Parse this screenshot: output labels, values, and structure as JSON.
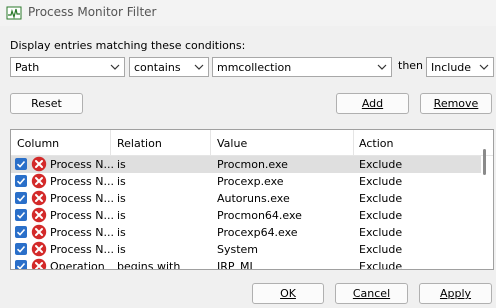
{
  "window": {
    "title": "Process Monitor Filter"
  },
  "conditions_label": "Display entries matching these conditions:",
  "filter": {
    "column": "Path",
    "relation": "contains",
    "value": "mmcollection",
    "then_label": "then",
    "action": "Include"
  },
  "buttons": {
    "reset": "Reset",
    "add": "Add",
    "remove": "Remove",
    "ok": "OK",
    "cancel": "Cancel",
    "apply": "Apply"
  },
  "table": {
    "headers": [
      "Column",
      "Relation",
      "Value",
      "Action"
    ],
    "rows": [
      {
        "column": "Process N...",
        "relation": "is",
        "value": "Procmon.exe",
        "action": "Exclude",
        "checked": true,
        "selected": true
      },
      {
        "column": "Process N...",
        "relation": "is",
        "value": "Procexp.exe",
        "action": "Exclude",
        "checked": true
      },
      {
        "column": "Process N...",
        "relation": "is",
        "value": "Autoruns.exe",
        "action": "Exclude",
        "checked": true
      },
      {
        "column": "Process N...",
        "relation": "is",
        "value": "Procmon64.exe",
        "action": "Exclude",
        "checked": true
      },
      {
        "column": "Process N...",
        "relation": "is",
        "value": "Procexp64.exe",
        "action": "Exclude",
        "checked": true
      },
      {
        "column": "Process N...",
        "relation": "is",
        "value": "System",
        "action": "Exclude",
        "checked": true
      },
      {
        "column": "Operation",
        "relation": "begins with",
        "value": "IRP_MJ_",
        "action": "Exclude",
        "checked": true
      }
    ]
  },
  "colors": {
    "check": "#2a6fc9",
    "exclude_icon": "#d32a2a",
    "selected_row": "#dfdfdf"
  },
  "icons": {
    "app": "process-monitor-icon",
    "exclude": "exclude-x-icon",
    "check": "checkmark-icon",
    "chevron": "chevron-down-icon"
  }
}
